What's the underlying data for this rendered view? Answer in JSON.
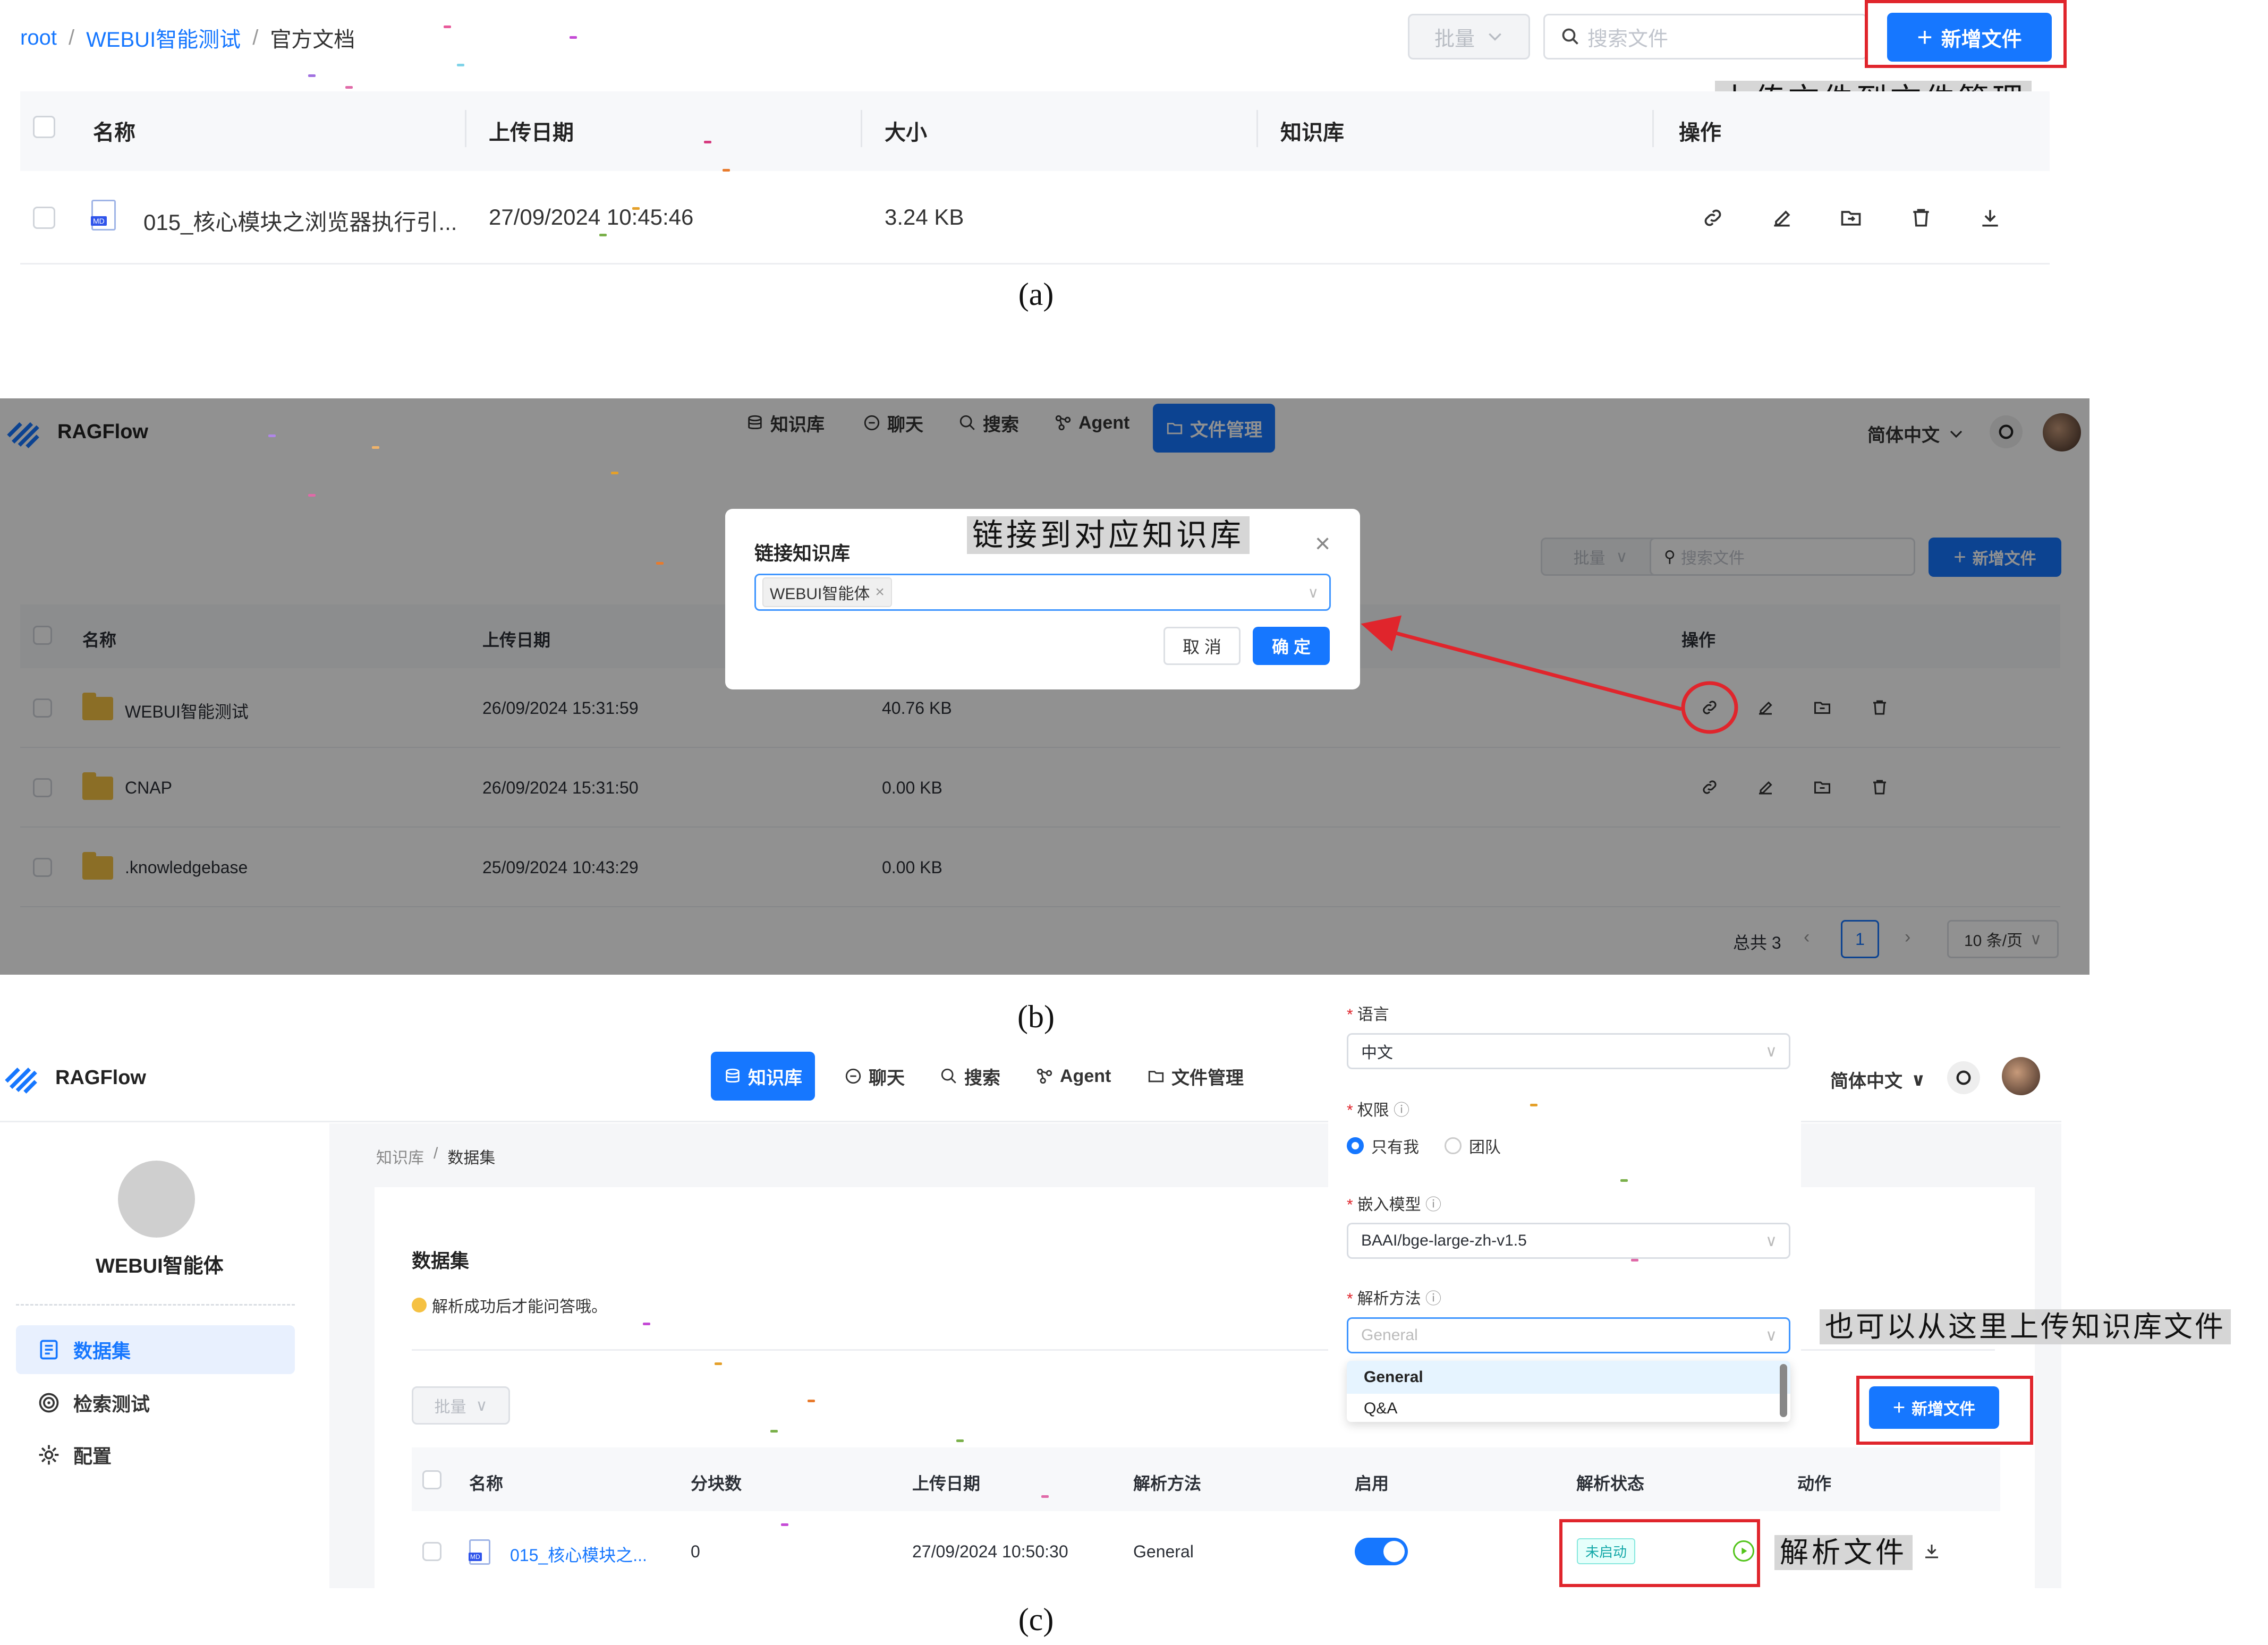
{
  "panel_a": {
    "breadcrumb": [
      "root",
      "WEBUI智能测试",
      "官方文档"
    ],
    "breadcrumb_sep": "/",
    "bulk_label": "批量",
    "search_placeholder": "搜索文件",
    "new_file_label": "新增文件",
    "annotation": "上传文件到文件管理",
    "columns": [
      "名称",
      "上传日期",
      "大小",
      "知识库",
      "操作"
    ],
    "row": {
      "name": "015_核心模块之浏览器执行引...",
      "date": "27/09/2024 10:45:46",
      "size": "3.24 KB",
      "file_badge": "MD"
    },
    "actions": [
      "link-icon",
      "edit-icon",
      "move-icon",
      "delete-icon",
      "download-icon"
    ],
    "caption": "(a)"
  },
  "panel_b": {
    "brand": "RAGFlow",
    "nav": [
      {
        "label": "知识库",
        "icon": "database-icon"
      },
      {
        "label": "聊天",
        "icon": "chat-icon"
      },
      {
        "label": "搜索",
        "icon": "search-icon"
      },
      {
        "label": "Agent",
        "icon": "agent-icon"
      },
      {
        "label": "文件管理",
        "icon": "folder-icon",
        "active": true
      }
    ],
    "lang": "简体中文",
    "bulk_label": "批量",
    "search_placeholder": "搜索文件",
    "new_file_label": "新增文件",
    "columns": [
      "名称",
      "上传日期",
      "操作"
    ],
    "rows": [
      {
        "name": "WEBUI智能测试",
        "date": "26/09/2024 15:31:59",
        "size": "40.76 KB"
      },
      {
        "name": "CNAP",
        "date": "26/09/2024 15:31:50",
        "size": "0.00 KB"
      },
      {
        "name": ".knowledgebase",
        "date": "25/09/2024 10:43:29",
        "size": "0.00 KB"
      }
    ],
    "pagination": {
      "total": "总共 3",
      "current": "1",
      "page_size": "10 条/页"
    },
    "modal": {
      "title": "链接知识库",
      "tag": "WEBUI智能体",
      "cancel": "取 消",
      "ok": "确 定"
    },
    "annotation": "链接到对应知识库",
    "caption": "(b)"
  },
  "panel_c": {
    "brand": "RAGFlow",
    "nav": [
      {
        "label": "知识库",
        "icon": "database-icon",
        "active": true
      },
      {
        "label": "聊天",
        "icon": "chat-icon"
      },
      {
        "label": "搜索",
        "icon": "search-icon"
      },
      {
        "label": "Agent",
        "icon": "agent-icon"
      },
      {
        "label": "文件管理",
        "icon": "folder-icon"
      }
    ],
    "lang": "简体中文",
    "kb_name": "WEBUI智能体",
    "side_menu": [
      {
        "label": "数据集",
        "icon": "document-icon",
        "active": true
      },
      {
        "label": "检索测试",
        "icon": "target-icon"
      },
      {
        "label": "配置",
        "icon": "gear-icon"
      }
    ],
    "breadcrumb": [
      "知识库",
      "数据集"
    ],
    "section_title": "数据集",
    "tip": "解析成功后才能问答哦。",
    "bulk_label": "批量",
    "new_file_label": "新增文件",
    "columns": [
      "名称",
      "分块数",
      "上传日期",
      "解析方法",
      "启用",
      "解析状态",
      "动作"
    ],
    "row": {
      "name": "015_核心模块之...",
      "chunks": "0",
      "date": "27/09/2024 10:50:30",
      "method": "General",
      "status": "未启动",
      "file_badge": "MD"
    },
    "settings": {
      "language_label": "语言",
      "language_value": "中文",
      "permission_label": "权限",
      "perm_options": [
        "只有我",
        "团队"
      ],
      "embedding_label": "嵌入模型",
      "embedding_value": "BAAI/bge-large-zh-v1.5",
      "parse_label": "解析方法",
      "parse_placeholder": "General",
      "parse_options": [
        "General",
        "Q&A"
      ]
    },
    "annotation_upload": "也可以从这里上传知识库文件",
    "annotation_parse": "解析文件",
    "caption": "(c)"
  },
  "colors": {
    "accent": "#1677ff",
    "annotation_red": "#e0252c",
    "annotation_bg": "#d2d2d2"
  }
}
